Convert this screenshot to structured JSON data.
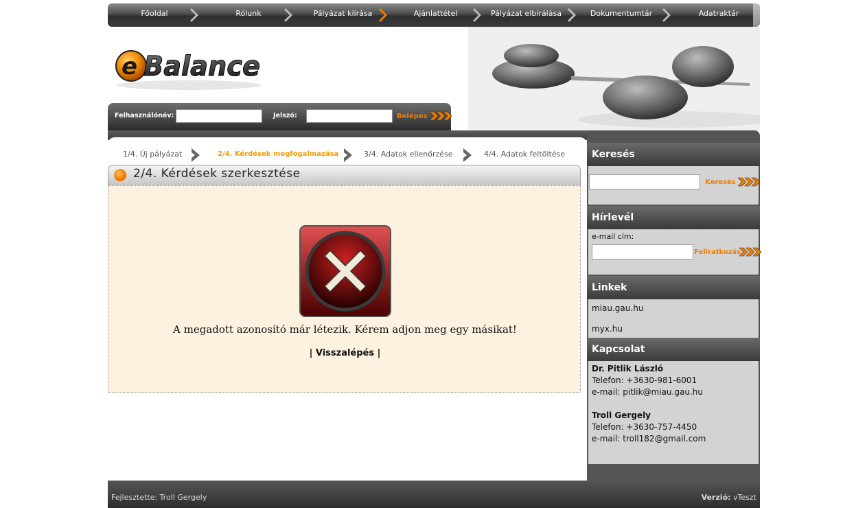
{
  "nav": {
    "items": [
      "Főoldal",
      "Rólunk",
      "Pályázat kiírása",
      "Ajánlattétel",
      "Pályázat elbírálása",
      "Dokumentumtár",
      "Adatraktár"
    ]
  },
  "logo": {
    "text_e": "e",
    "text_rest": "Balance"
  },
  "login": {
    "username_label": "Felhasználónév:",
    "password_label": "Jelszó:",
    "username_value": "",
    "password_value": "",
    "submit_label": "Belépés"
  },
  "steps": [
    "1/4. Új pályázat",
    "2/4. Kérdések megfogalmazása",
    "3/4. Adatok ellenőrzése",
    "4/4. Adatok feltöltése"
  ],
  "panel": {
    "title": "2/4. Kérdések szerkesztése",
    "error_message": "A megadott azonosító már létezik. Kérem adjon meg egy másikat!",
    "back_link": "| Visszalépés |"
  },
  "sidebar": {
    "search": {
      "title": "Keresés",
      "value": "",
      "button": "Keresés"
    },
    "newsletter": {
      "title": "Hírlevél",
      "email_label": "e-mail cím:",
      "value": "",
      "button": "Feliratkozás"
    },
    "links": {
      "title": "Linkek",
      "items": [
        "miau.gau.hu",
        "myx.hu"
      ]
    },
    "contact": {
      "title": "Kapcsolat",
      "person1": {
        "name": "Dr. Pitlik László",
        "phone": "Telefon: +3630-981-6001",
        "email": "e-mail: pitlik@miau.gau.hu"
      },
      "person2": {
        "name": "Troll Gergely",
        "phone": "Telefon: +3630-757-4450",
        "email": "e-mail: troll182@gmail.com"
      }
    }
  },
  "footer": {
    "developer": "Fejlesztette: Troll Gergely",
    "version_label": "Verzió:",
    "version_value": "vTeszt"
  },
  "colors": {
    "accent": "#f07c00",
    "active_step": "#f09b00",
    "panel_bg": "#fdf2e0",
    "error_red": "#c00000"
  }
}
